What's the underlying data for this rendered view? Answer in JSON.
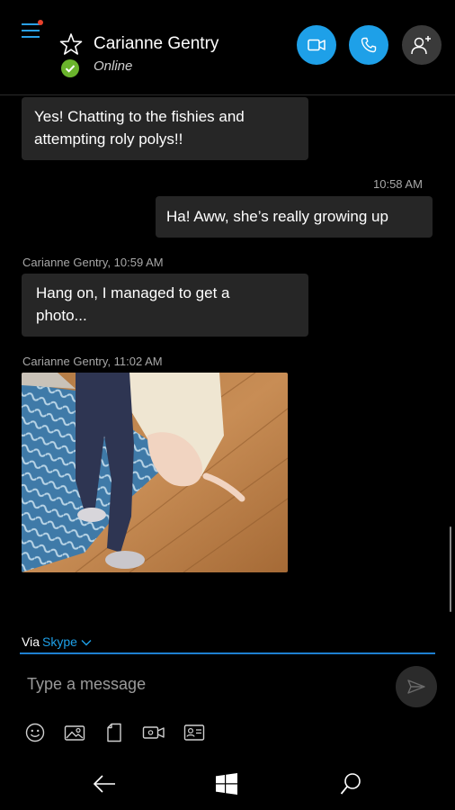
{
  "header": {
    "contact_name": "Carianne Gentry",
    "presence": "Online",
    "accent_color": "#1ea0e8",
    "presence_color": "#6ab42c",
    "icons": [
      "hamburger-icon",
      "star-icon",
      "video-call-icon",
      "phone-icon",
      "add-person-icon"
    ]
  },
  "conversation": {
    "msg1": {
      "line1": "Yes! Chatting to the fishies and",
      "line2": "attempting roly polys!!"
    },
    "time2": "10:58 AM",
    "msg2": "Ha! Aww, she’s really growing up",
    "meta3": "Carianne Gentry, 10:59 AM",
    "msg3": {
      "line1": "Hang on, I managed to get a",
      "line2": "photo..."
    },
    "meta4": "Carianne Gentry, 11:02 AM"
  },
  "compose": {
    "via_label": "Via",
    "service": "Skype",
    "placeholder": "Type a message",
    "tools": [
      "emoticon-icon",
      "photo-icon",
      "file-icon",
      "video-message-icon",
      "contact-card-icon"
    ]
  },
  "navbar": {
    "icons": [
      "back-arrow-icon",
      "windows-logo-icon",
      "search-icon"
    ]
  }
}
